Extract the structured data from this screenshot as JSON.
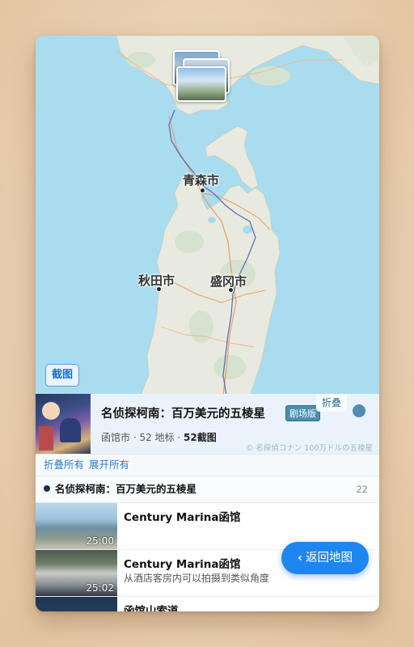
{
  "map": {
    "cities": [
      {
        "name": "青森市"
      },
      {
        "name": "秋田市"
      },
      {
        "name": "盛冈市"
      }
    ],
    "screenshot_button": "截图"
  },
  "work": {
    "title": "名侦探柯南：百万美元的五棱星",
    "badge": "剧场版",
    "fold_button": "折叠",
    "city": "函馆市",
    "landmarks": "52 地标",
    "screenshots": "52截图",
    "sep": " · ",
    "copyright": "© 名探偵コナン 100万ドルの五稜星"
  },
  "controls": {
    "collapse_all": "折叠所有",
    "expand_all": "展开所有"
  },
  "section": {
    "title": "名侦探柯南：百万美元的五棱星",
    "count": "22"
  },
  "spots": [
    {
      "name": "Century Marina函馆",
      "time": "25:00",
      "desc": ""
    },
    {
      "name": "Century Marina函馆",
      "time": "25:02",
      "desc": "从酒店客房内可以拍摄到类似角度"
    },
    {
      "name": "函馆山索道",
      "time": "",
      "desc": ""
    }
  ],
  "back_button": "返回地图",
  "colors": {
    "sea": "#a9dcef",
    "land": "#e9eadf",
    "accent": "#1f86f0",
    "badge": "#4a8fb2"
  }
}
